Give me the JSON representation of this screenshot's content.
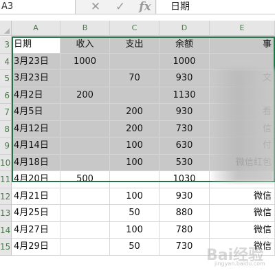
{
  "formula_bar": {
    "name_box": "A3",
    "cancel_icon": "cancel-icon",
    "enter_icon": "check-icon",
    "function_icon": "fx-icon",
    "content": "日期"
  },
  "columns": [
    "A",
    "B",
    "C",
    "D",
    "E"
  ],
  "rows": [
    {
      "num": "3",
      "cells": [
        "日期",
        "收入",
        "支出",
        "余额",
        "事"
      ]
    },
    {
      "num": "4",
      "cells": [
        "3月23日",
        "1000",
        "",
        "1000",
        ""
      ]
    },
    {
      "num": "5",
      "cells": [
        "3月23日",
        "",
        "70",
        "930",
        "文"
      ]
    },
    {
      "num": "6",
      "cells": [
        "4月2日",
        "200",
        "",
        "1130",
        ""
      ]
    },
    {
      "num": "7",
      "cells": [
        "4月5日",
        "",
        "200",
        "930",
        "看"
      ]
    },
    {
      "num": "8",
      "cells": [
        "4月12日",
        "",
        "200",
        "730",
        "信"
      ]
    },
    {
      "num": "9",
      "cells": [
        "4月14日",
        "",
        "100",
        "630",
        "付"
      ]
    },
    {
      "num": "10",
      "cells": [
        "4月18日",
        "",
        "100",
        "530",
        "微信红包"
      ]
    },
    {
      "num": "11",
      "cells": [
        "4月20日",
        "500",
        "",
        "1030",
        ""
      ]
    },
    {
      "num": "12",
      "cells": [
        "4月21日",
        "",
        "100",
        "930",
        "微信"
      ]
    },
    {
      "num": "13",
      "cells": [
        "4月25日",
        "",
        "50",
        "880",
        "微信"
      ]
    },
    {
      "num": "14",
      "cells": [
        "4月27日",
        "",
        "100",
        "780",
        "微信"
      ]
    },
    {
      "num": "15",
      "cells": [
        "4月29日",
        "",
        "50",
        "730",
        "微信"
      ]
    }
  ],
  "selection": {
    "range": "A3:E10",
    "accent": "#217346",
    "fill": "#c8c8c8"
  },
  "watermark": {
    "text": "Bai经验",
    "sub": "jingyan.baidu.com"
  }
}
